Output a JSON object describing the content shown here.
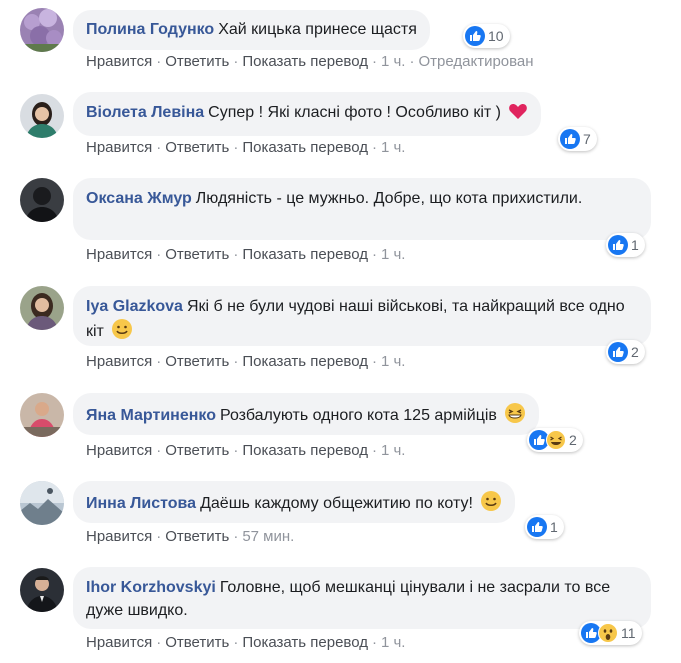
{
  "actions": {
    "like": "Нравится",
    "reply": "Ответить",
    "translate": "Показать перевод",
    "separator": "·"
  },
  "colors": {
    "author": "#385898",
    "bubble": "#f2f3f5",
    "like_blue": "#1877f2",
    "meta": "#90949c"
  },
  "comments": [
    {
      "author": "Полина Годунко",
      "text": "Хай кицька принесе щастя",
      "emoji": "",
      "time": "1 ч.",
      "edited": "Отредактирован",
      "reactions": [
        "like-icon"
      ],
      "count": "10",
      "avatar": "lilac-flowers"
    },
    {
      "author": "Віолета Левіна",
      "text": "Супер ! Які класні фото ! Особливо кіт )",
      "emoji": "red-heart-emoji",
      "time": "1 ч.",
      "edited": "",
      "reactions": [
        "like-icon"
      ],
      "count": "7",
      "avatar": "woman-portrait"
    },
    {
      "author": "Оксана Жмур",
      "text": "Людяність - це мужньо. Добре, що кота прихистили.",
      "emoji": "",
      "time": "1 ч.",
      "edited": "",
      "reactions": [
        "like-icon"
      ],
      "count": "1",
      "avatar": "dark-silhouette"
    },
    {
      "author": "Iya Glazkova",
      "text": "Які б не були чудові наші військові, та найкращий все одно кіт",
      "emoji": "smiling-face-emoji",
      "time": "1 ч.",
      "edited": "",
      "reactions": [
        "like-icon"
      ],
      "count": "2",
      "avatar": "woman-portrait"
    },
    {
      "author": "Яна Мартиненко",
      "text": "Розбалують одного кота 125 армійців",
      "emoji": "grinning-squinting-emoji",
      "time": "1 ч.",
      "edited": "",
      "reactions": [
        "like-icon",
        "laugh-icon"
      ],
      "count": "2",
      "avatar": "woman-outdoors"
    },
    {
      "author": "Инна Листова",
      "text": "Даёшь каждому общежитию по коту!",
      "emoji": "smiling-face-emoji",
      "time": "57 мин.",
      "edited": "",
      "reactions": [
        "like-icon"
      ],
      "count": "1",
      "avatar": "landscape"
    },
    {
      "author": "Ihor Korzhovskyi",
      "text": "Головне, щоб мешканці цінували і не засрали то все дуже швидко.",
      "emoji": "",
      "time": "1 ч.",
      "edited": "",
      "reactions": [
        "like-icon",
        "wow-icon"
      ],
      "count": "11",
      "avatar": "man-in-suit"
    }
  ]
}
